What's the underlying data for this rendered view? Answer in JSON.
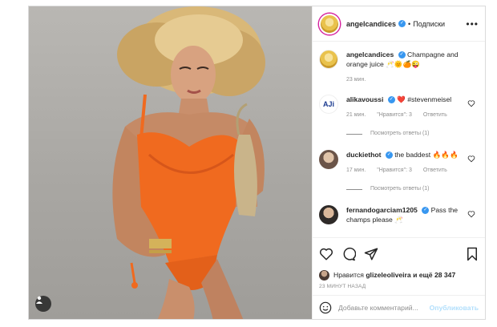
{
  "post": {
    "author": "angelcandices",
    "separator": "•",
    "follow_label": "Подписки",
    "more_icon": "more-horizontal-icon",
    "caption": {
      "user": "angelcandices",
      "text": "Champagne and orange juice 🥂🌞🍊😜",
      "time": "23 мин."
    },
    "comments": [
      {
        "user": "alikavoussi",
        "text": "❤️ #stevenmeisel",
        "time": "21 мин.",
        "likes": "\"Нравится\": 3",
        "reply": "Ответить",
        "view_replies": "Посмотреть ответы (1)"
      },
      {
        "user": "duckiethot",
        "text": "the baddest 🔥🔥🔥",
        "time": "17 мин.",
        "likes": "\"Нравится\": 3",
        "reply": "Ответить",
        "view_replies": "Посмотреть ответы (1)"
      },
      {
        "user": "fernandogarciam1205",
        "text": "Pass the champs please 🥂"
      }
    ],
    "liked_by_prefix": "Нравится",
    "liked_by_user": "glizeleoliveira",
    "liked_by_more": "и ещё 28 347",
    "timestamp": "23 МИНУТ НАЗАД",
    "comment_placeholder": "Добавьте комментарий...",
    "publish_label": "Опубликовать"
  },
  "colors": {
    "verified": "#3897f0",
    "swimsuit": "#f06a1f",
    "publish_disabled": "#b2dffc",
    "story_ring": "#d6249f"
  }
}
